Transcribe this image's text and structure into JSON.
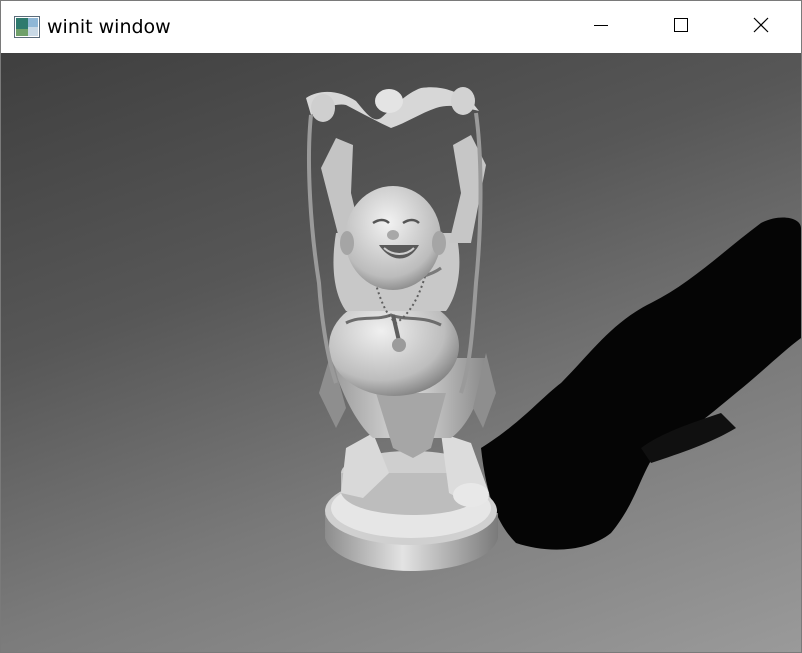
{
  "window": {
    "title": "winit window",
    "icon": "winit-app-icon",
    "controls": {
      "minimize_icon": "minimize-icon",
      "maximize_icon": "maximize-icon",
      "close_icon": "close-icon"
    }
  },
  "viewport": {
    "scene": "rendered-3d-figurine",
    "background_top": "#3f3f3f",
    "background_bottom": "#9a9a9a",
    "model_color": "#d9d9d9",
    "shadow_color": "#000000"
  }
}
